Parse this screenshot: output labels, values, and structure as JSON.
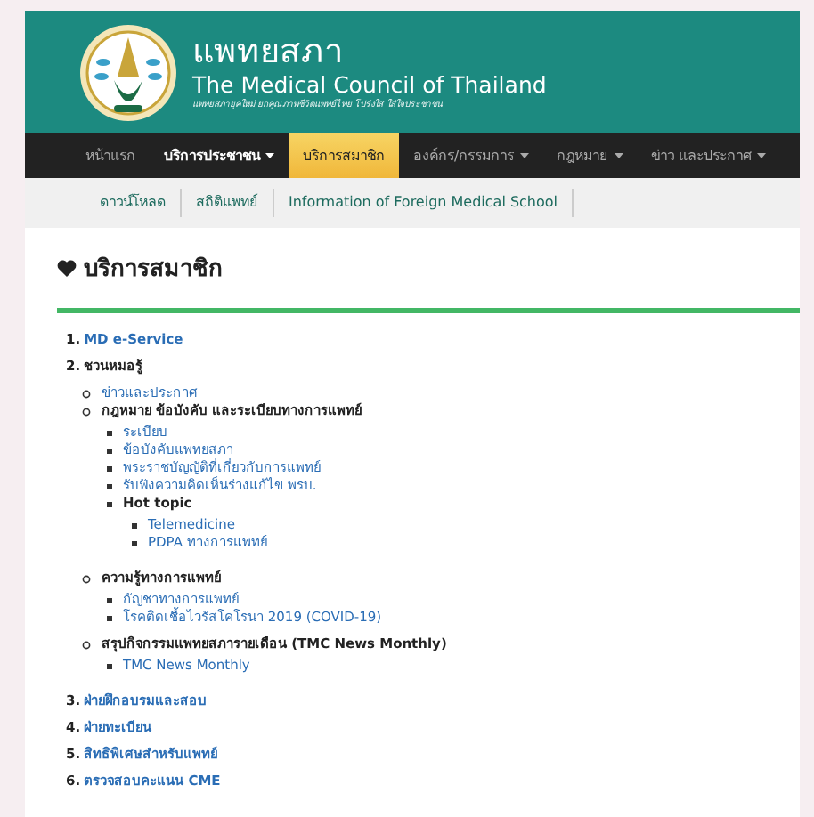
{
  "header": {
    "title_thai": "แพทยสภา",
    "title_english": "The Medical Council of Thailand",
    "tagline": "แพทยสภายุคใหม่ ยกคุณภาพชีวิตแพทย์ไทย โปร่งใส ใส่ใจประชาชน"
  },
  "nav": [
    {
      "label": "หน้าแรก",
      "selected": false,
      "dropdown": false,
      "bold": false
    },
    {
      "label": "บริการประชาชน",
      "selected": false,
      "dropdown": true,
      "bold": true
    },
    {
      "label": "บริการสมาชิก",
      "selected": true,
      "dropdown": false,
      "bold": false
    },
    {
      "label": "องค์กร/กรรมการ",
      "selected": false,
      "dropdown": true,
      "bold": false
    },
    {
      "label": "กฎหมาย",
      "selected": false,
      "dropdown": true,
      "bold": false
    },
    {
      "label": "ข่าว และประกาศ",
      "selected": false,
      "dropdown": true,
      "bold": false
    }
  ],
  "subnav": [
    "ดาวน์โหลด",
    "สถิติแพทย์",
    "Information of Foreign Medical School"
  ],
  "page_title": "บริการสมาชิก",
  "sections": [
    {
      "number": "1.",
      "label": "MD e-Service",
      "kind": "link"
    },
    {
      "number": "2.",
      "label": "ชวนหมอรู้",
      "kind": "label",
      "children": [
        {
          "label": "ข่าวและประกาศ",
          "kind": "link"
        },
        {
          "label": "กฎหมาย ข้อบังคับ และระเบียบทางการแพทย์",
          "kind": "label",
          "children": [
            {
              "label": "ระเบียบ",
              "kind": "link"
            },
            {
              "label": "ข้อบังคับแพทยสภา",
              "kind": "link"
            },
            {
              "label": "พระราชบัญญัติที่เกี่ยวกับการแพทย์",
              "kind": "link"
            },
            {
              "label": "รับฟังความคิดเห็นร่างแก้ไข พรบ.",
              "kind": "link"
            },
            {
              "label": "Hot topic",
              "kind": "label",
              "children": [
                {
                  "label": "Telemedicine",
                  "kind": "link"
                },
                {
                  "label": "PDPA ทางการแพทย์",
                  "kind": "link"
                }
              ]
            }
          ]
        },
        {
          "label": "ความรู้ทางการแพทย์",
          "kind": "label",
          "children": [
            {
              "label": "กัญชาทางการแพทย์",
              "kind": "link"
            },
            {
              "label": "โรคติดเชื้อไวรัสโคโรนา 2019 (COVID-19)",
              "kind": "link"
            }
          ]
        },
        {
          "label": "สรุปกิจกรรมแพทยสภารายเดือน (TMC News Monthly)",
          "kind": "label",
          "children": [
            {
              "label": "TMC News Monthly",
              "kind": "link"
            }
          ]
        }
      ]
    },
    {
      "number": "3.",
      "label": "ฝ่ายฝึกอบรมและสอบ",
      "kind": "link"
    },
    {
      "number": "4.",
      "label": "ฝ่ายทะเบียน",
      "kind": "link"
    },
    {
      "number": "5.",
      "label": "สิทธิพิเศษสำหรับแพทย์",
      "kind": "link"
    },
    {
      "number": "6.",
      "label": "ตรวจสอบคะแนน CME",
      "kind": "link"
    }
  ]
}
